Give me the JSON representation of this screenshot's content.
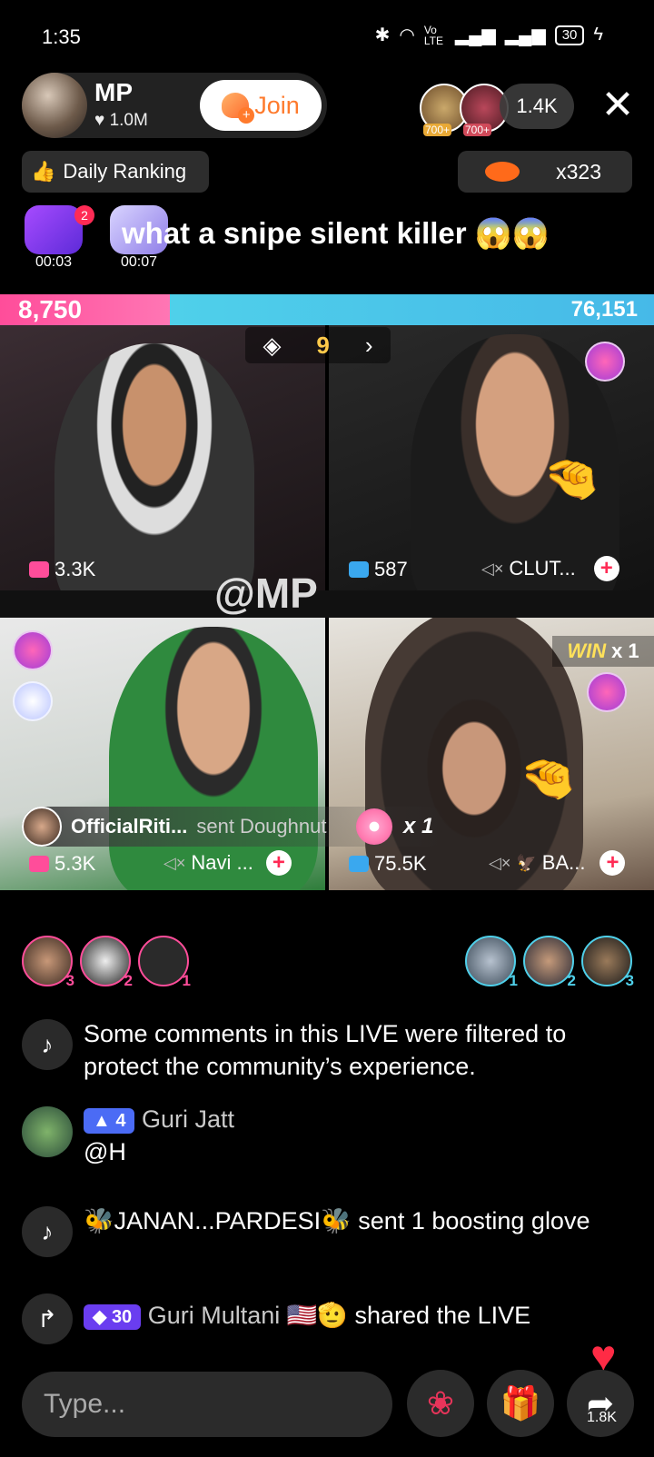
{
  "status_bar": {
    "time": "1:35",
    "net": "Vo LTE",
    "battery": "30"
  },
  "host": {
    "name": "MP",
    "likes": "1.0M",
    "join_label": "Join"
  },
  "viewers": {
    "count": "1.4K",
    "badges": [
      "700+",
      "700+"
    ]
  },
  "daily_ranking": {
    "label": "Daily Ranking"
  },
  "coins": {
    "label": "x323"
  },
  "gifts": [
    {
      "time": "00:03"
    },
    {
      "time": "00:07"
    }
  ],
  "notification_count": "2",
  "marquee": "what a snipe silent killer 😱😱",
  "battle": {
    "left_score": "8,750",
    "right_score": "76,151",
    "left_share": 0.26,
    "gem_count": "9"
  },
  "tiles": [
    {
      "count": "3.3K"
    },
    {
      "count": "587",
      "name": "CLUT..."
    },
    {
      "count": "5.3K",
      "name": "Navi ..."
    },
    {
      "count": "75.5K",
      "name": "BA..."
    }
  ],
  "overlay_handle": "@MP",
  "win": {
    "label": "WIN",
    "count": "x 1"
  },
  "gift_toast": {
    "user": "OfficialRiti...",
    "text": "sent Doughnut",
    "count": "x 1"
  },
  "contributors_left": [
    "3",
    "2",
    "1"
  ],
  "contributors_right": [
    "1",
    "2",
    "3"
  ],
  "comments": [
    {
      "text": "Some comments in this LIVE were filtered to protect the community’s experience."
    },
    {
      "level": "4",
      "user": "Guri Jatt",
      "text": "@H"
    },
    {
      "text": "🐝JANAN...PARDESI🐝 sent 1 boosting glove"
    },
    {
      "level": "30",
      "user": "Guri Multani 🇺🇸🫡",
      "text": "shared the LIVE"
    }
  ],
  "input": {
    "placeholder": "Type..."
  },
  "share": {
    "count": "1.8K"
  },
  "colors": {
    "accent": "#ff2b55",
    "battle_left": "#ff4d9a",
    "battle_right": "#46b9e8",
    "join": "#fe7a2c"
  }
}
